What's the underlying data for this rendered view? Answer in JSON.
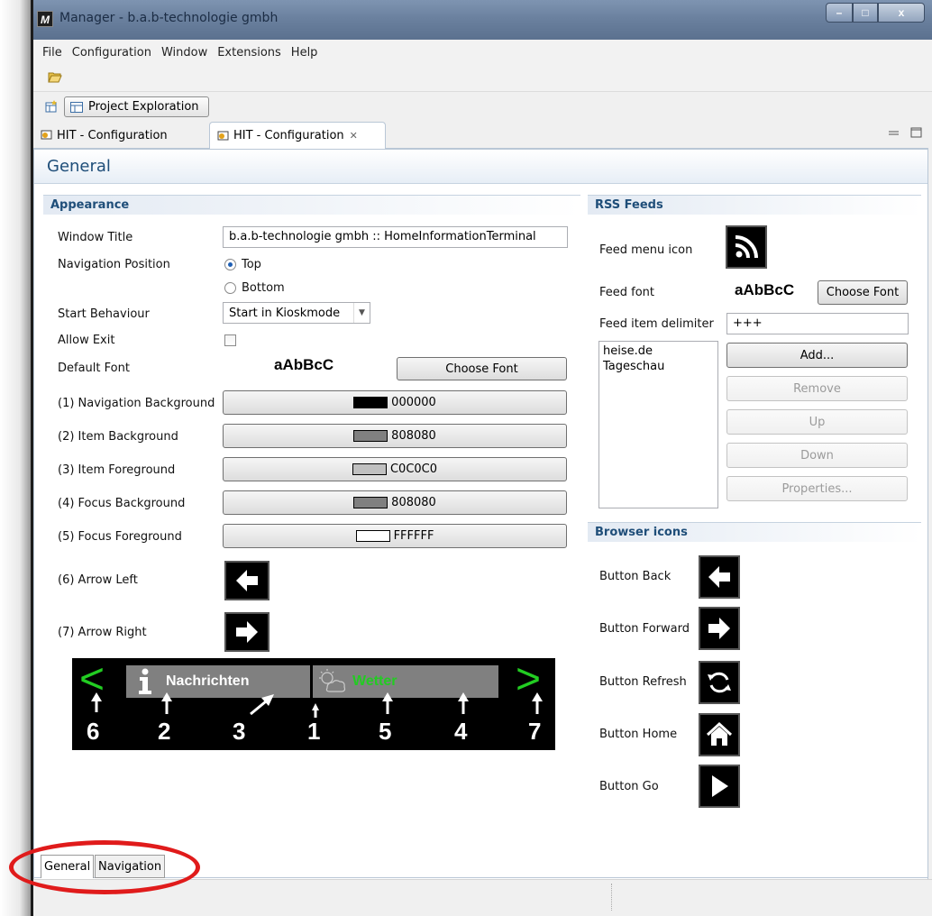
{
  "window": {
    "app_icon_letter": "M",
    "title": "Manager - b.a.b-technologie gmbh",
    "min_label": "–",
    "max_label": "□",
    "close_label": "x"
  },
  "menu": [
    "File",
    "Configuration",
    "Window",
    "Extensions",
    "Help"
  ],
  "perspective": {
    "label": "Project Exploration"
  },
  "editor_tabs": [
    {
      "label": "HIT - Configuration"
    },
    {
      "label": "HIT - Configuration",
      "close": "✕"
    }
  ],
  "form": {
    "title": "General"
  },
  "appearance": {
    "heading": "Appearance",
    "window_title_label": "Window Title",
    "window_title_value": "b.a.b-technologie gmbh :: HomeInformationTerminal",
    "nav_position_label": "Navigation Position",
    "nav_top": "Top",
    "nav_bottom": "Bottom",
    "start_behaviour_label": "Start Behaviour",
    "start_behaviour_value": "Start in Kioskmode",
    "allow_exit_label": "Allow Exit",
    "default_font_label": "Default Font",
    "font_sample": "aAbBcC",
    "choose_font": "Choose Font",
    "colors": [
      {
        "label": "(1) Navigation Background",
        "value": "000000",
        "hex": "#000000"
      },
      {
        "label": "(2) Item Background",
        "value": "808080",
        "hex": "#808080"
      },
      {
        "label": "(3) Item Foreground",
        "value": "C0C0C0",
        "hex": "#C0C0C0"
      },
      {
        "label": "(4) Focus Background",
        "value": "808080",
        "hex": "#808080"
      },
      {
        "label": "(5) Focus Foreground",
        "value": "FFFFFF",
        "hex": "#FFFFFF"
      }
    ],
    "arrow_left_label": "(6) Arrow Left",
    "arrow_right_label": "(7) Arrow Right"
  },
  "preview": {
    "left_arrow": "<",
    "right_arrow": ">",
    "item1": "Nachrichten",
    "item2": "Wetter",
    "numbers": [
      "6",
      "2",
      "3",
      "1",
      "5",
      "4",
      "7"
    ],
    "accent": "#22cc22"
  },
  "rss": {
    "heading": "RSS Feeds",
    "menu_icon_label": "Feed menu icon",
    "font_label": "Feed font",
    "font_sample": "aAbBcC",
    "choose_font": "Choose Font",
    "delimiter_label": "Feed item delimiter",
    "delimiter_value": "+++",
    "feeds": [
      "heise.de",
      "Tageschau"
    ],
    "add": "Add...",
    "remove": "Remove",
    "up": "Up",
    "down": "Down",
    "properties": "Properties..."
  },
  "browser": {
    "heading": "Browser icons",
    "back": "Button Back",
    "forward": "Button Forward",
    "refresh": "Button Refresh",
    "home": "Button Home",
    "go": "Button Go"
  },
  "bottom_tabs": [
    "General",
    "Navigation"
  ]
}
